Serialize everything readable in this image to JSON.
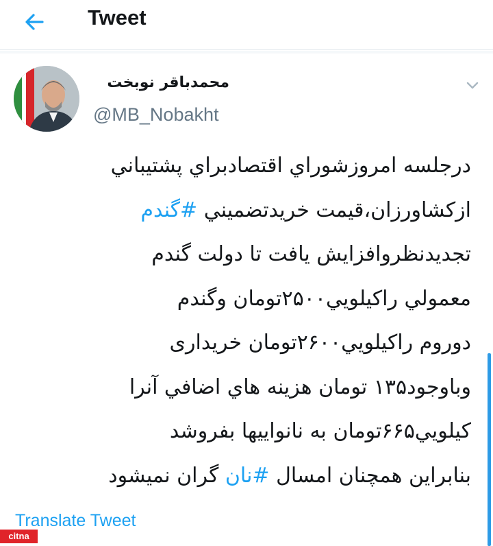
{
  "header": {
    "title": "Tweet",
    "back_icon": "arrow-left-icon"
  },
  "tweet": {
    "display_name": "محمدباقر نوبخت",
    "username": "@MB_Nobakht",
    "menu_icon": "chevron-down-icon",
    "lines": [
      {
        "text": "درجلسه امروزشوراي اقتصادبراي پشتيباني"
      },
      {
        "before": "ازكشاورزان،قيمت خريدتضميني ",
        "hashtag": "#گندم",
        "after": ""
      },
      {
        "text": "تجديدنظروافزايش يافت تا دولت گندم"
      },
      {
        "text": "معمولي راكيلويي۲۵۰۰تومان وگندم"
      },
      {
        "text": "دوروم راكيلويي۲۶۰۰تومان خريداری"
      },
      {
        "text": "وباوجود۱۳۵ تومان هزينه هاي اضافي آنرا"
      },
      {
        "text": "كيلويي۶۶۵تومان به نانواييها بفروشد"
      },
      {
        "before": "بنابراين همچنان امسال ",
        "hashtag": "#نان",
        "after": " گران نميشود"
      }
    ],
    "translate_label": "Translate Tweet"
  },
  "watermark": "citna",
  "colors": {
    "accent": "#1da1f2",
    "text": "#14171a",
    "muted": "#657786"
  }
}
